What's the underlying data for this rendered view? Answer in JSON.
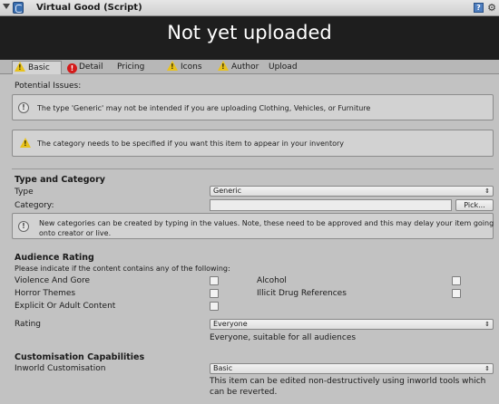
{
  "window": {
    "title": "Virtual Good (Script)"
  },
  "banner": {
    "status": "Not yet uploaded"
  },
  "tabs": [
    {
      "label": "Basic",
      "icon": "warning-icon"
    },
    {
      "label": "Detail",
      "icon": "error-icon"
    },
    {
      "label": "Pricing"
    },
    {
      "label": "Icons",
      "icon": "warning-icon"
    },
    {
      "label": "Author",
      "icon": "warning-icon"
    },
    {
      "label": "Upload"
    }
  ],
  "issues": {
    "heading": "Potential Issues:",
    "info": "The type 'Generic' may not be intended if you are uploading Clothing, Vehicles, or Furniture",
    "warning": "The category needs to be specified if you want this item to appear in your inventory"
  },
  "type_category": {
    "heading": "Type and Category",
    "type_label": "Type",
    "type_value": "Generic",
    "category_label": "Category:",
    "category_value": "",
    "pick_label": "Pick...",
    "note_line1": "New categories can be created by typing in the values. Note, these need to be approved and this may delay your item going",
    "note_line2": "onto creator or live."
  },
  "audience": {
    "heading": "Audience Rating",
    "prompt": "Please indicate if the content contains any of the following:",
    "items": [
      {
        "label": "Violence And Gore",
        "checked": false
      },
      {
        "label": "Horror Themes",
        "checked": false
      },
      {
        "label": "Explicit Or Adult Content",
        "checked": false
      },
      {
        "label": "Alcohol",
        "checked": false
      },
      {
        "label": "Illicit Drug References",
        "checked": false
      }
    ],
    "rating_label": "Rating",
    "rating_value": "Everyone",
    "rating_desc": "Everyone, suitable for all audiences"
  },
  "customisation": {
    "heading": "Customisation Capabilities",
    "label": "Inworld Customisation",
    "value": "Basic",
    "desc_line1": "This item can be edited non-destructively using inworld tools which",
    "desc_line2": "can be reverted."
  }
}
